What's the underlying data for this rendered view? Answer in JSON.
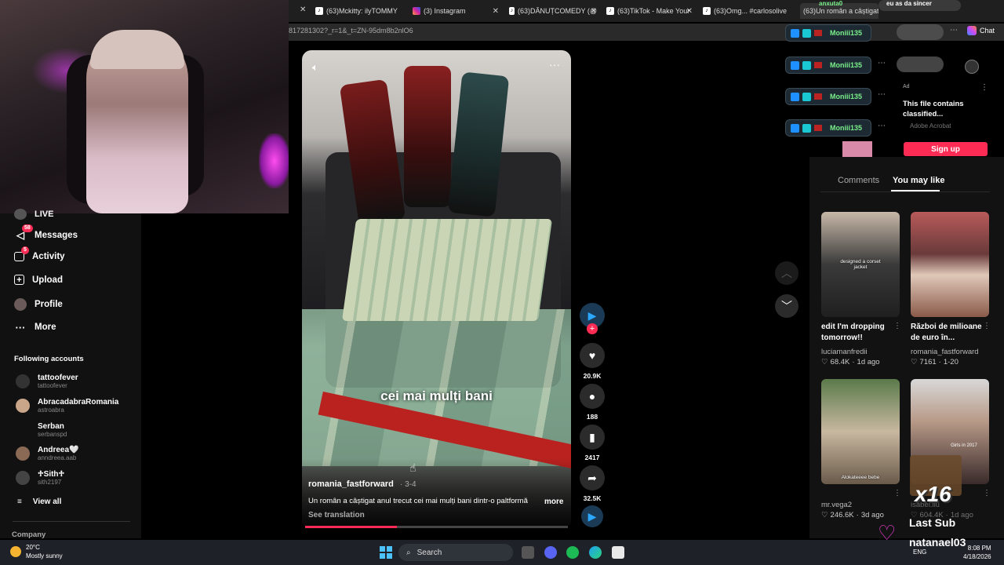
{
  "tabs": [
    {
      "label": "(63)Mckitty: ilyTOMMY",
      "icon": "tiktok"
    },
    {
      "label": "(3) Instagram",
      "icon": "instagram"
    },
    {
      "label": "(63)DĂNUȚCOMEDY (@",
      "icon": "tiktok"
    },
    {
      "label": "(63)TikTok - Make Your",
      "icon": "tiktok"
    },
    {
      "label": "(63)Omg... #carlosolive",
      "icon": "tiktok"
    },
    {
      "label": "(63)Un român a câștigat",
      "icon": "tiktok"
    }
  ],
  "url": "817281302?_r=1&_t=ZN-95dm8b2nlO6",
  "header": {
    "chat_label": "Chat"
  },
  "sidebar": {
    "live_label": "LIVE",
    "items": [
      {
        "label": "Messages",
        "badge": "58",
        "icon": "paper-plane-icon"
      },
      {
        "label": "Activity",
        "badge": "5",
        "icon": "activity-icon"
      },
      {
        "label": "Upload",
        "badge": "",
        "icon": "plus-square-icon"
      },
      {
        "label": "Profile",
        "badge": "",
        "icon": "profile-icon"
      },
      {
        "label": "More",
        "badge": "",
        "icon": "more-dots-icon"
      }
    ],
    "following_title": "Following accounts",
    "accounts": [
      {
        "name": "tattoofever",
        "handle": "tattoofever"
      },
      {
        "name": "AbracadabraRomania",
        "handle": "astroabra"
      },
      {
        "name": "Serban",
        "handle": "serbanspd"
      },
      {
        "name": "Andreea🤍",
        "handle": "anndreea.aab"
      },
      {
        "name": "♱Sith♱",
        "handle": "sith2197"
      }
    ],
    "view_all": "View all",
    "company": "Company"
  },
  "video": {
    "caption": "cei mai mulți bani",
    "author": "romania_fastforward",
    "date": "· 3-4",
    "description": "Un român a câștigat anul trecut cei mai mulți bani dintr-o paltformă",
    "more": "more",
    "see_translation": "See translation",
    "progress": 0.35,
    "likes": "20.9K",
    "comments": "188",
    "saves": "2417",
    "shares": "32.5K"
  },
  "overlay": {
    "streamer_top": "anxuta0",
    "streamer_msg": "eu as da sincer",
    "pill_names": [
      "Moniii135",
      "Moniii135",
      "Moniii135",
      "Moniii135"
    ],
    "ad_label": "Ad",
    "ad_text": "This file contains classified...",
    "ad_sub": "Adobe Acrobat",
    "sign_up": "Sign up",
    "counter": "x16",
    "last_sub_label": "Last Sub",
    "last_sub_name": "natanael03"
  },
  "panel": {
    "tabs": [
      "Comments",
      "You may like"
    ],
    "active_tab": "You may like",
    "cards": [
      {
        "title": "edit I'm dropping tomorrow!!",
        "overlay": "designed a corset jacket",
        "user": "luciamanfredii",
        "likes": "68.4K",
        "date": "1d ago"
      },
      {
        "title": "Război de milioane de euro în...",
        "overlay": "",
        "user": "romania_fastforward",
        "likes": "7161",
        "date": "1-20"
      },
      {
        "title": "",
        "overlay": "Alokateeee bebe",
        "user": "mr.vega2",
        "likes": "246.6K",
        "date": "3d ago"
      },
      {
        "title": "",
        "overlay": "Girls in 2017",
        "user": "isabel.liu",
        "likes": "604.4K",
        "date": "1d ago"
      }
    ]
  },
  "taskbar": {
    "temperature": "20°C",
    "weather": "Mostly sunny",
    "search": "Search",
    "lang": "ENG",
    "time": "8:08 PM",
    "date": "4/18/2026"
  },
  "colors": {
    "accent": "#fe2c55",
    "panel": "#121212",
    "taskbar": "#1e2228"
  }
}
